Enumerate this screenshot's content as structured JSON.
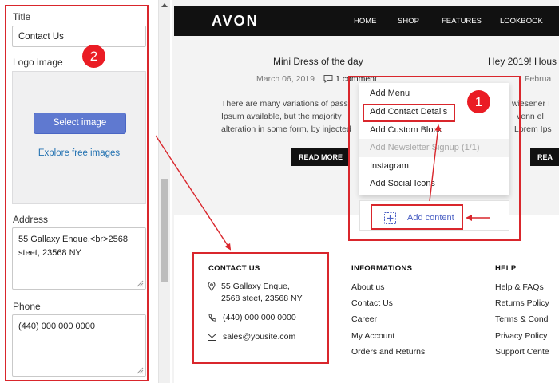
{
  "settings_panel": {
    "title_label": "Title",
    "title_value": "Contact Us",
    "logo_label": "Logo image",
    "select_image_button": "Select image",
    "explore_link": "Explore free images",
    "address_label": "Address",
    "address_value": "55 Gallaxy Enque,<br>2568 steet, 23568 NY",
    "phone_label": "Phone",
    "phone_value": "(440) 000 000 0000"
  },
  "badges": {
    "menu": "1",
    "panel": "2"
  },
  "site": {
    "brand": "AVON",
    "nav": [
      "HOME",
      "SHOP",
      "FEATURES",
      "LOOKBOOK"
    ],
    "posts": [
      {
        "title": "Mini Dress of the day",
        "date": "March 06, 2019",
        "comments": "1 comment",
        "excerpt": [
          "There are many variations of pass",
          "Ipsum available, but the majority",
          "alteration in some form, by injected"
        ],
        "read_more": "READ MORE"
      },
      {
        "title": "Hey 2019! Hous",
        "date": "Februa",
        "excerpt": [
          "wiesener I",
          "venn el",
          "Lorem Ips"
        ],
        "read_more": "REA"
      }
    ],
    "footer": {
      "contact": {
        "heading": "CONTACT US",
        "address_line1": "55 Gallaxy Enque,",
        "address_line2": "2568 steet, 23568 NY",
        "phone": "(440) 000 000 0000",
        "email": "sales@yousite.com"
      },
      "informations": {
        "heading": "INFORMATIONS",
        "links": [
          "About us",
          "Contact Us",
          "Career",
          "My Account",
          "Orders and Returns"
        ]
      },
      "help": {
        "heading": "HELP",
        "links": [
          "Help & FAQs",
          "Returns Policy",
          "Terms & Cond",
          "Privacy Policy",
          "Support Cente"
        ]
      }
    }
  },
  "menu": {
    "items": [
      {
        "label": "Add Menu",
        "disabled": false
      },
      {
        "label": "Add Contact Details",
        "disabled": false
      },
      {
        "label": "Add Custom Block",
        "disabled": false
      },
      {
        "label": "Add Newsletter Signup (1/1)",
        "disabled": true
      },
      {
        "label": "Instagram",
        "disabled": false
      },
      {
        "label": "Add Social Icons",
        "disabled": false
      }
    ],
    "add_content": "Add content"
  },
  "colors": {
    "annotation_red": "#d9262c",
    "badge_red": "#ea1c24",
    "primary_blue": "#5f79d0",
    "link_blue": "#2271b1"
  }
}
